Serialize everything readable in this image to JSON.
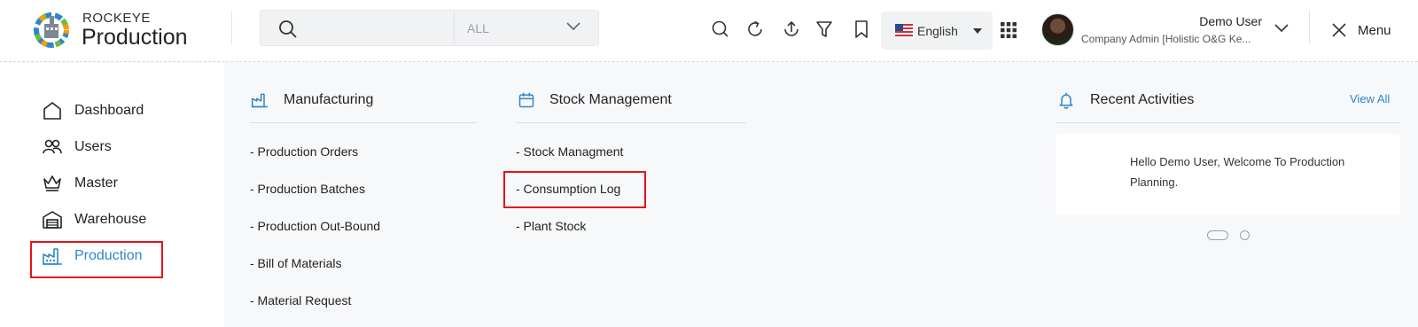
{
  "header": {
    "brand_top": "ROCKEYE",
    "brand_main": "Production",
    "search": {
      "placeholder": "",
      "scope": "ALL"
    },
    "icons": [
      "search-icon",
      "refresh-icon",
      "upload-icon",
      "filter-icon",
      "bookmark-icon"
    ],
    "language": "English",
    "user": {
      "name": "Demo User",
      "role": "Company Admin [Holistic O&G Ke..."
    },
    "menu_label": "Menu"
  },
  "sidebar": {
    "items": [
      {
        "label": "Dashboard",
        "icon": "home-icon"
      },
      {
        "label": "Users",
        "icon": "users-icon"
      },
      {
        "label": "Master",
        "icon": "crown-icon"
      },
      {
        "label": "Warehouse",
        "icon": "warehouse-icon"
      },
      {
        "label": "Production",
        "icon": "factory-icon",
        "active": true
      }
    ]
  },
  "manufacturing": {
    "title": "Manufacturing",
    "links": [
      "- Production Orders",
      "- Production Batches",
      "- Production Out-Bound",
      "- Bill of Materials",
      "- Material Request"
    ]
  },
  "stock": {
    "title": "Stock Management",
    "links": [
      "- Stock Managment",
      "- Consumption Log",
      "- Plant Stock"
    ]
  },
  "activities": {
    "title": "Recent Activities",
    "view_all": "View All",
    "message": "Hello Demo User, Welcome To Production Planning."
  },
  "colors": {
    "accent": "#2f86c7",
    "highlight": "#e3131b"
  }
}
